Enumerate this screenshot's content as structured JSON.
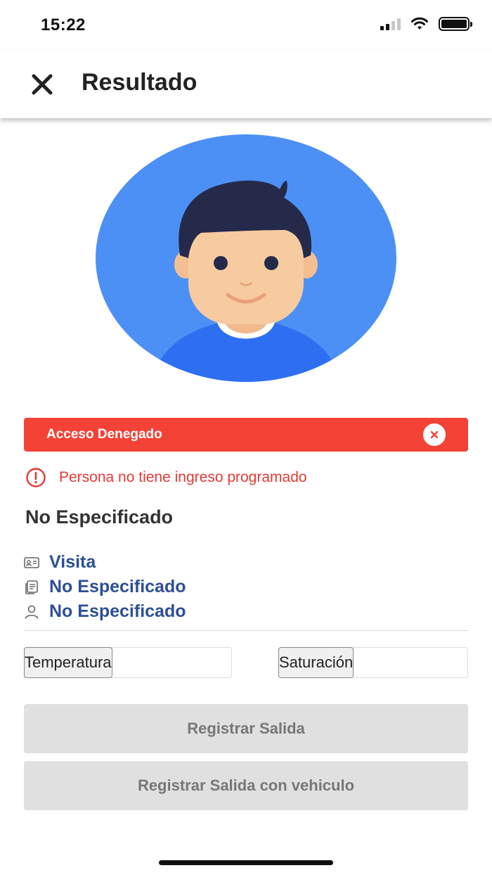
{
  "status_bar": {
    "time": "15:22",
    "icons": [
      "signal-icon",
      "wifi-icon",
      "battery-icon"
    ]
  },
  "header": {
    "close_icon": "close-icon",
    "title": "Resultado"
  },
  "avatar": {
    "icon": "person-avatar-icon",
    "colors": {
      "background": "#4d90f5",
      "hair": "#252a4a",
      "skin": "#f7cba0",
      "shirt": "#2e6ff2"
    }
  },
  "alert": {
    "label": "Acceso Denegado",
    "color": "#f44336",
    "close_icon": "close-circle-icon"
  },
  "warning": {
    "icon": "info-circle-icon",
    "text": "Persona no tiene ingreso programado",
    "color": "#e53935"
  },
  "person": {
    "name": "No Especificado"
  },
  "details": [
    {
      "icon": "id-card-icon",
      "text": "Visita"
    },
    {
      "icon": "document-icon",
      "text": "No Especificado"
    },
    {
      "icon": "user-icon",
      "text": "No Especificado"
    }
  ],
  "measurements": {
    "temperature": {
      "label": "Temperatura",
      "value": ""
    },
    "saturation": {
      "label": "Saturación",
      "value": ""
    }
  },
  "actions": {
    "register_exit": "Registrar Salida",
    "register_exit_vehicle": "Registrar Salida con vehiculo"
  }
}
